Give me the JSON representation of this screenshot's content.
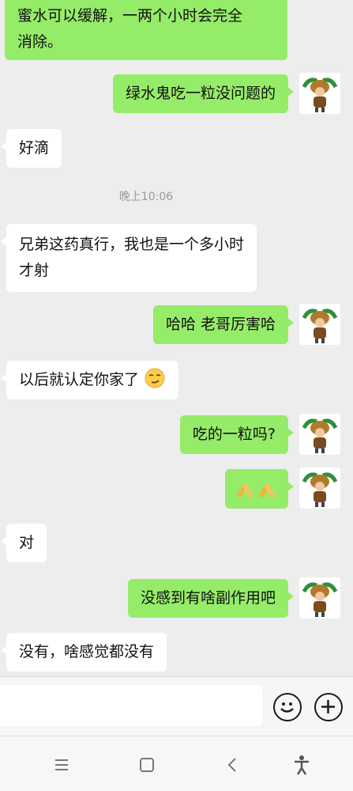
{
  "messages": [
    {
      "side": "out",
      "text_line1": "蜜水可以缓解，一两个小时会完全",
      "text_line2": "消除。"
    },
    {
      "side": "out",
      "text": "绿水鬼吃一粒没问题的"
    },
    {
      "side": "in",
      "text": "好滴"
    },
    {
      "side": "in",
      "text_line1": "兄弟这药真行，我也是一个多小时",
      "text_line2": "才射"
    },
    {
      "side": "out",
      "text": "哈哈 老哥厉害哈"
    },
    {
      "side": "in",
      "text": "以后就认定你家了",
      "trailing_emoji": "smirk-emoji"
    },
    {
      "side": "out",
      "text": "吃的一粒吗?"
    },
    {
      "side": "out",
      "emoji": "pray-hands-emoji ×2"
    },
    {
      "side": "in",
      "text": "对"
    },
    {
      "side": "out",
      "text": "没感到有啥副作用吧"
    },
    {
      "side": "in",
      "text": "没有，啥感觉都没有"
    }
  ],
  "timestamp": "晚上10:06",
  "input": {
    "placeholder": ""
  },
  "icons": {
    "emoji_button": "smiley-icon",
    "plus_button": "plus-icon",
    "nav": [
      "menu-icon",
      "home-square-icon",
      "back-chevron-icon",
      "accessibility-icon"
    ]
  },
  "colors": {
    "outgoing_bubble": "#95ec69",
    "incoming_bubble": "#ffffff",
    "background": "#ededed"
  }
}
